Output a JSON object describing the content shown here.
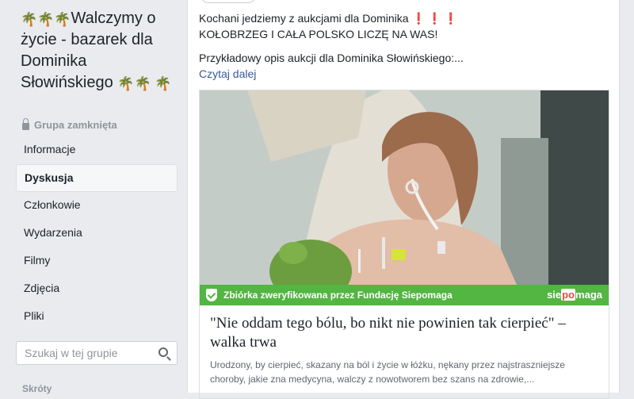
{
  "group": {
    "title_line": "Walczymy o życie - bazarek dla Dominika Słowińskiego",
    "palm_icon": "palm-tree-emoji",
    "privacy": "Grupa zamknięta"
  },
  "nav": {
    "items": [
      {
        "label": "Informacje",
        "active": false
      },
      {
        "label": "Dyskusja",
        "active": true
      },
      {
        "label": "Członkowie",
        "active": false
      },
      {
        "label": "Wydarzenia",
        "active": false
      },
      {
        "label": "Filmy",
        "active": false
      },
      {
        "label": "Zdjęcia",
        "active": false
      },
      {
        "label": "Pliki",
        "active": false
      }
    ]
  },
  "search": {
    "placeholder": "Szukaj w tej grupie"
  },
  "shortcuts_label": "Skróty",
  "post": {
    "line1": "Kochani jedziemy z aukcjami dla Dominika",
    "exclamations": "❗❗❗",
    "line2": "KOŁOBRZEG I CAŁA POLSKO LICZĘ NA WAS!",
    "line3": "Przykładowy opis aukcji dla Dominika Słowińskiego:...",
    "read_more": "Czytaj dalej"
  },
  "link_card": {
    "verified_text": "Zbiórka zweryfikowana przez Fundację Siepomaga",
    "brand_left": "sie",
    "brand_mid": "po",
    "brand_right": "maga",
    "headline": "\"Nie oddam tego bólu, bo nikt nie powinien tak cierpieć\" – walka trwa",
    "description": "Urodzony, by cierpieć, skazany na ból i życie w łóżku, nękany przez najstraszniejsze choroby, jakie zna medycyna, walczy z nowotworem bez szans na zdrowie,..."
  },
  "colors": {
    "link": "#385898",
    "verified_green": "#53b542",
    "background": "#e9ebee"
  }
}
